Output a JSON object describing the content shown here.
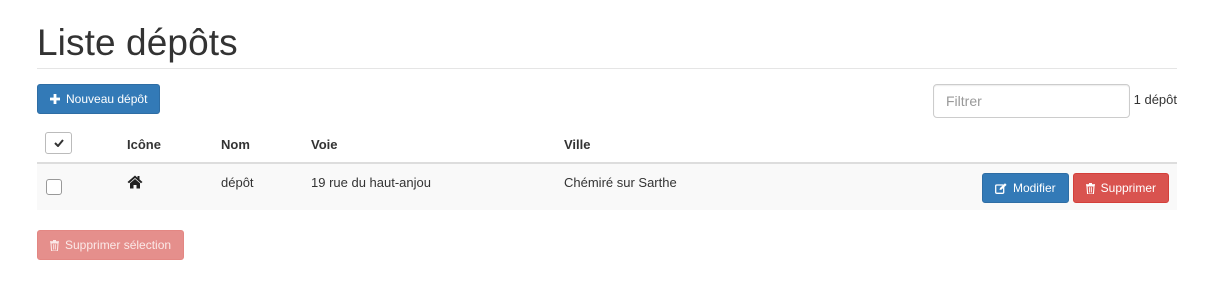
{
  "page": {
    "title": "Liste dépôts"
  },
  "toolbar": {
    "new_label": "Nouveau dépôt",
    "filter_placeholder": "Filtrer",
    "count_label": "1 dépôt"
  },
  "table": {
    "columns": [
      "",
      "Icône",
      "Nom",
      "Voie",
      "Ville"
    ],
    "rows": [
      {
        "icon": "home-icon",
        "nom": "dépôt",
        "voie": "19 rue du haut-anjou",
        "ville": "Chémiré sur Sarthe",
        "edit_label": "Modifier",
        "delete_label": "Supprimer"
      }
    ]
  },
  "footer": {
    "delete_selection_label": "Supprimer sélection"
  },
  "colors": {
    "primary": "#337ab7",
    "danger": "#d9534f",
    "danger_disabled": "#e58f8c"
  }
}
